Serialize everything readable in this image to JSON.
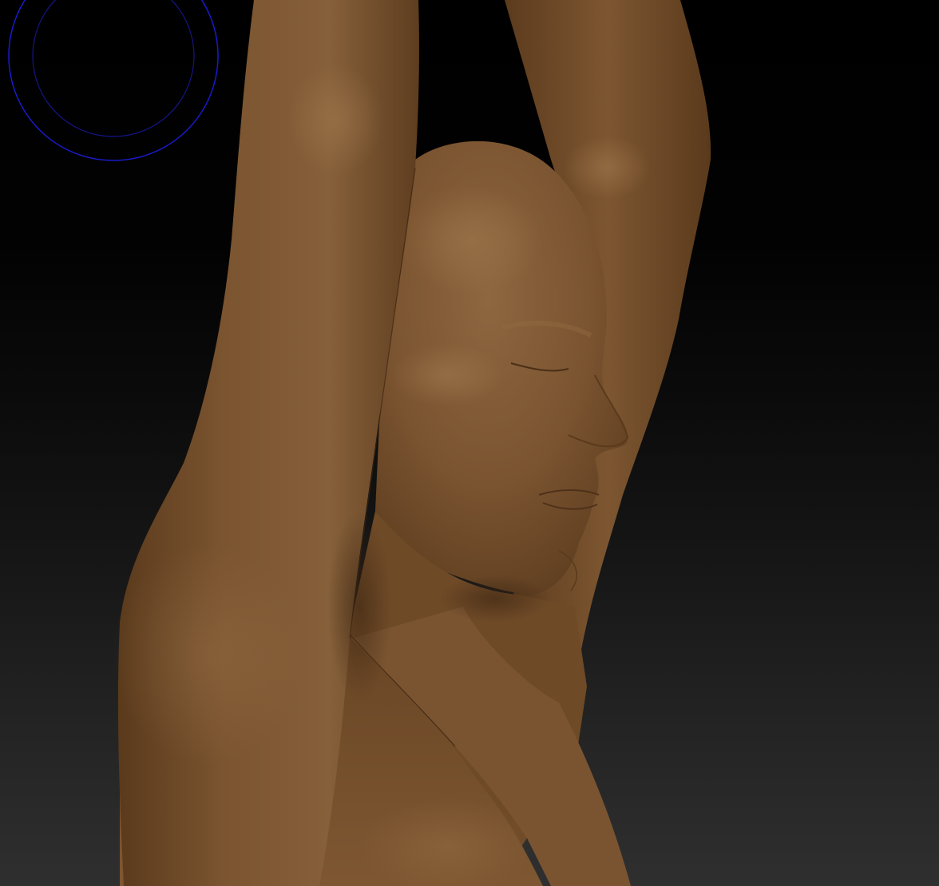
{
  "canvas": {
    "background_top": "#000000",
    "background_bottom": "#2f2f2f"
  },
  "brush_cursor": {
    "icon": "brush-circle-icon",
    "color": "#1a1acc"
  },
  "model": {
    "subject": "sculpted-female-bust",
    "material_color": "#7a5430",
    "highlight_color": "#94693d",
    "shadow_color": "#4e331a"
  }
}
